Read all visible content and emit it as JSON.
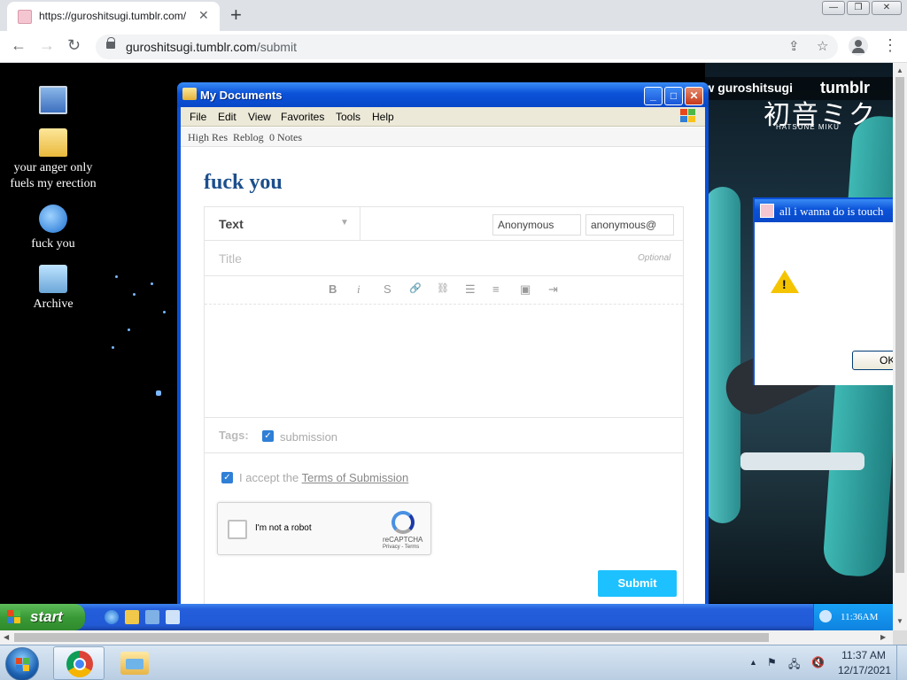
{
  "browser": {
    "tab_title": "https://guroshitsugi.tumblr.com/",
    "tab_close": "✕",
    "new_tab": "+",
    "window_buttons": {
      "minimize": "—",
      "restore": "❐",
      "close": "✕"
    },
    "url_domain": "guroshitsugi.tumblr.com",
    "url_path": "/submit",
    "nav": {
      "back": "←",
      "forward": "→",
      "reload": "↻"
    },
    "share_icon": "⇪",
    "bookmark_icon": "☆",
    "menu_icon": "⋮"
  },
  "desktop": {
    "icons": [
      {
        "label": "",
        "icon": "computer-icon"
      },
      {
        "label": "your anger only fuels my erection",
        "icon": "folder-icon"
      },
      {
        "label": "fuck you",
        "icon": "internet-explorer-icon"
      },
      {
        "label": "Archive",
        "icon": "recycle-bin-icon"
      }
    ]
  },
  "tumblr": {
    "follow_text": "Follow guroshitsugi",
    "logo": "tumblr",
    "art_logo": "初音ミク",
    "art_logo_sub": "HATSUNE MIKU"
  },
  "window": {
    "title": "My Documents",
    "menu": [
      "File",
      "Edit",
      "View",
      "Favorites",
      "Tools",
      "Help"
    ],
    "bar_links": [
      "High Res",
      "Reblog",
      "0 Notes"
    ],
    "buttons": {
      "minimize": "_",
      "maximize": "□",
      "close": "✕"
    }
  },
  "form": {
    "heading": "fuck you",
    "post_type": "Text",
    "caret": "▼",
    "name_value": "Anonymous",
    "email_value": "anonymous@",
    "title_placeholder": "Title",
    "optional_label": "Optional",
    "format_tools": [
      "B",
      "i",
      "S",
      "🔗",
      "⛓",
      "☰",
      "≡",
      "▣",
      "⇥"
    ],
    "tags_label": "Tags:",
    "tag_value": "submission",
    "tag_checked": true,
    "accept_prefix": "I accept the ",
    "accept_link": "Terms of Submission",
    "accept_checked": true,
    "captcha_label": "I'm not a robot",
    "captcha_brand": "reCAPTCHA",
    "captcha_links": "Privacy - Terms",
    "submit_label": "Submit",
    "checkmark": "✓"
  },
  "dialog": {
    "title": "all i wanna do is touch",
    "warning_mark": "!",
    "ok_label": "OK"
  },
  "xp_taskbar": {
    "start_label": "start",
    "clock": "11:36AM"
  },
  "win7_taskbar": {
    "time": "11:37 AM",
    "date": "12/17/2021",
    "tray_icons": [
      "▲",
      "⚑",
      "🖧",
      "🔇"
    ]
  },
  "colors": {
    "xp_blue": "#0a4fd6",
    "start_green": "#3a9a37",
    "submit_blue": "#1ec1ff",
    "heading_blue": "#1c4f8c"
  }
}
